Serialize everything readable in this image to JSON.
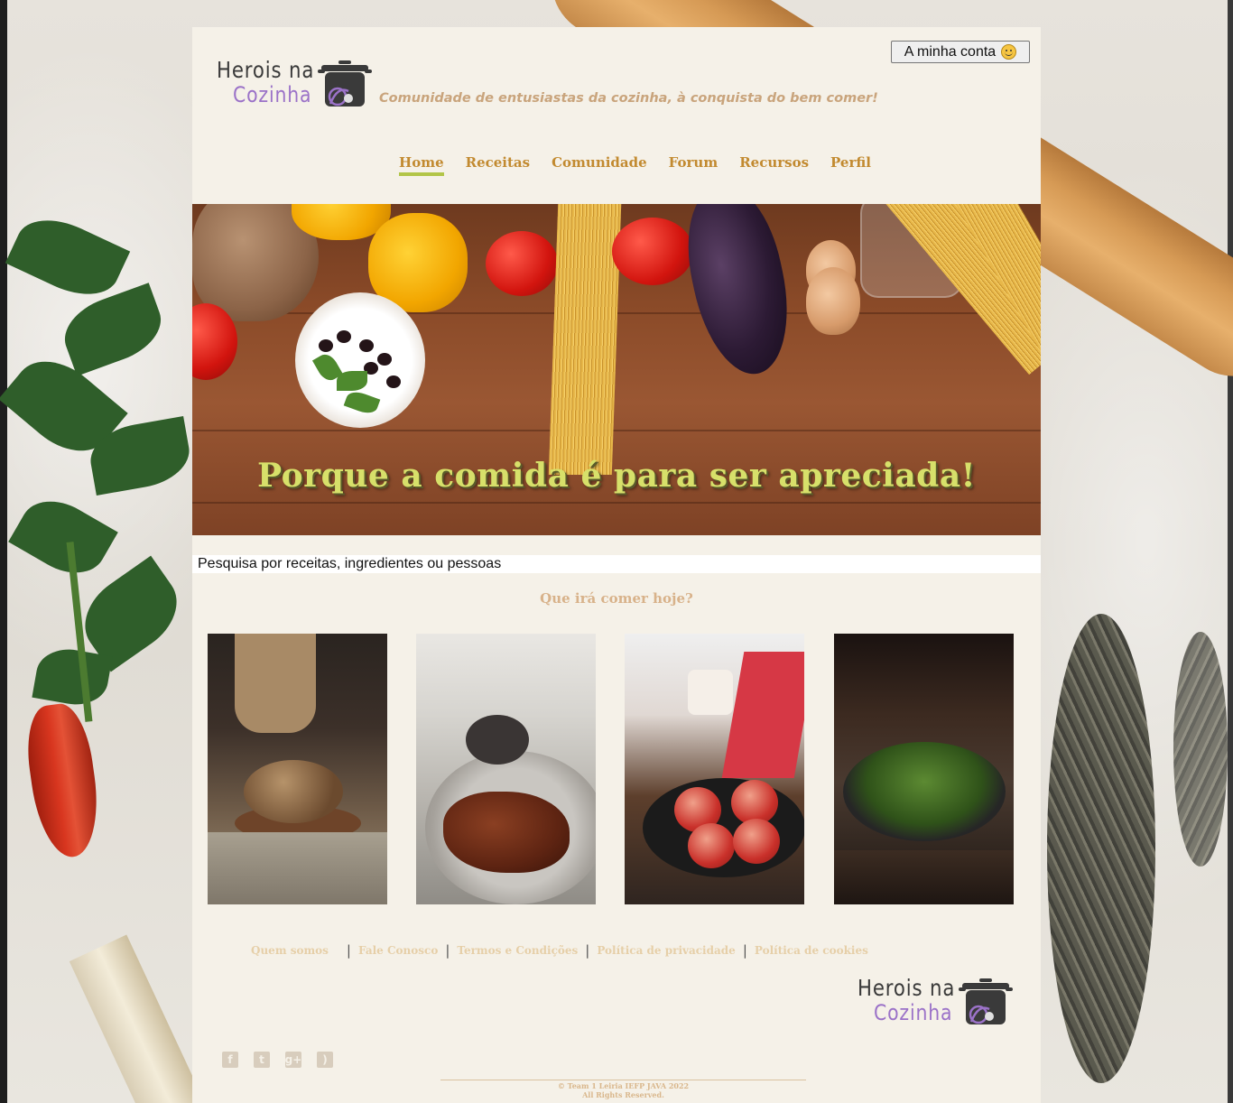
{
  "site": {
    "logo_line1": "Herois na",
    "logo_line2": "Cozinha",
    "tagline": "Comunidade de entusiastas da cozinha, à conquista do bem comer!"
  },
  "account": {
    "label": "A minha conta",
    "icon": "smiley-icon"
  },
  "nav": {
    "items": [
      {
        "label": "Home",
        "active": true
      },
      {
        "label": "Receitas"
      },
      {
        "label": "Comunidade"
      },
      {
        "label": "Forum"
      },
      {
        "label": "Recursos"
      },
      {
        "label": "Perfil"
      }
    ]
  },
  "hero": {
    "title": "Porque a comida é para ser apreciada!"
  },
  "search": {
    "placeholder": "Pesquisa por receitas, ingredientes ou pessoas"
  },
  "main": {
    "subtitle": "Que irá comer hoje?"
  },
  "footer": {
    "links": [
      "Quem somos",
      "Fale Conosco",
      "Termos e Condições",
      "Política de privacidade",
      "Política de cookies"
    ],
    "social_icons": [
      "facebook-icon",
      "twitter-icon",
      "google-plus-icon",
      "rss-icon"
    ],
    "copyright_line1": "© Team 1 Leiria IEFP JAVA 2022",
    "copyright_line2": "All Rights Reserved."
  },
  "colors": {
    "panel_bg": "#f5f1e8",
    "nav_text": "#c28a30",
    "nav_active_underline": "#b2c548",
    "hero_title": "#d7e06a",
    "tagline": "#c9a47c"
  }
}
